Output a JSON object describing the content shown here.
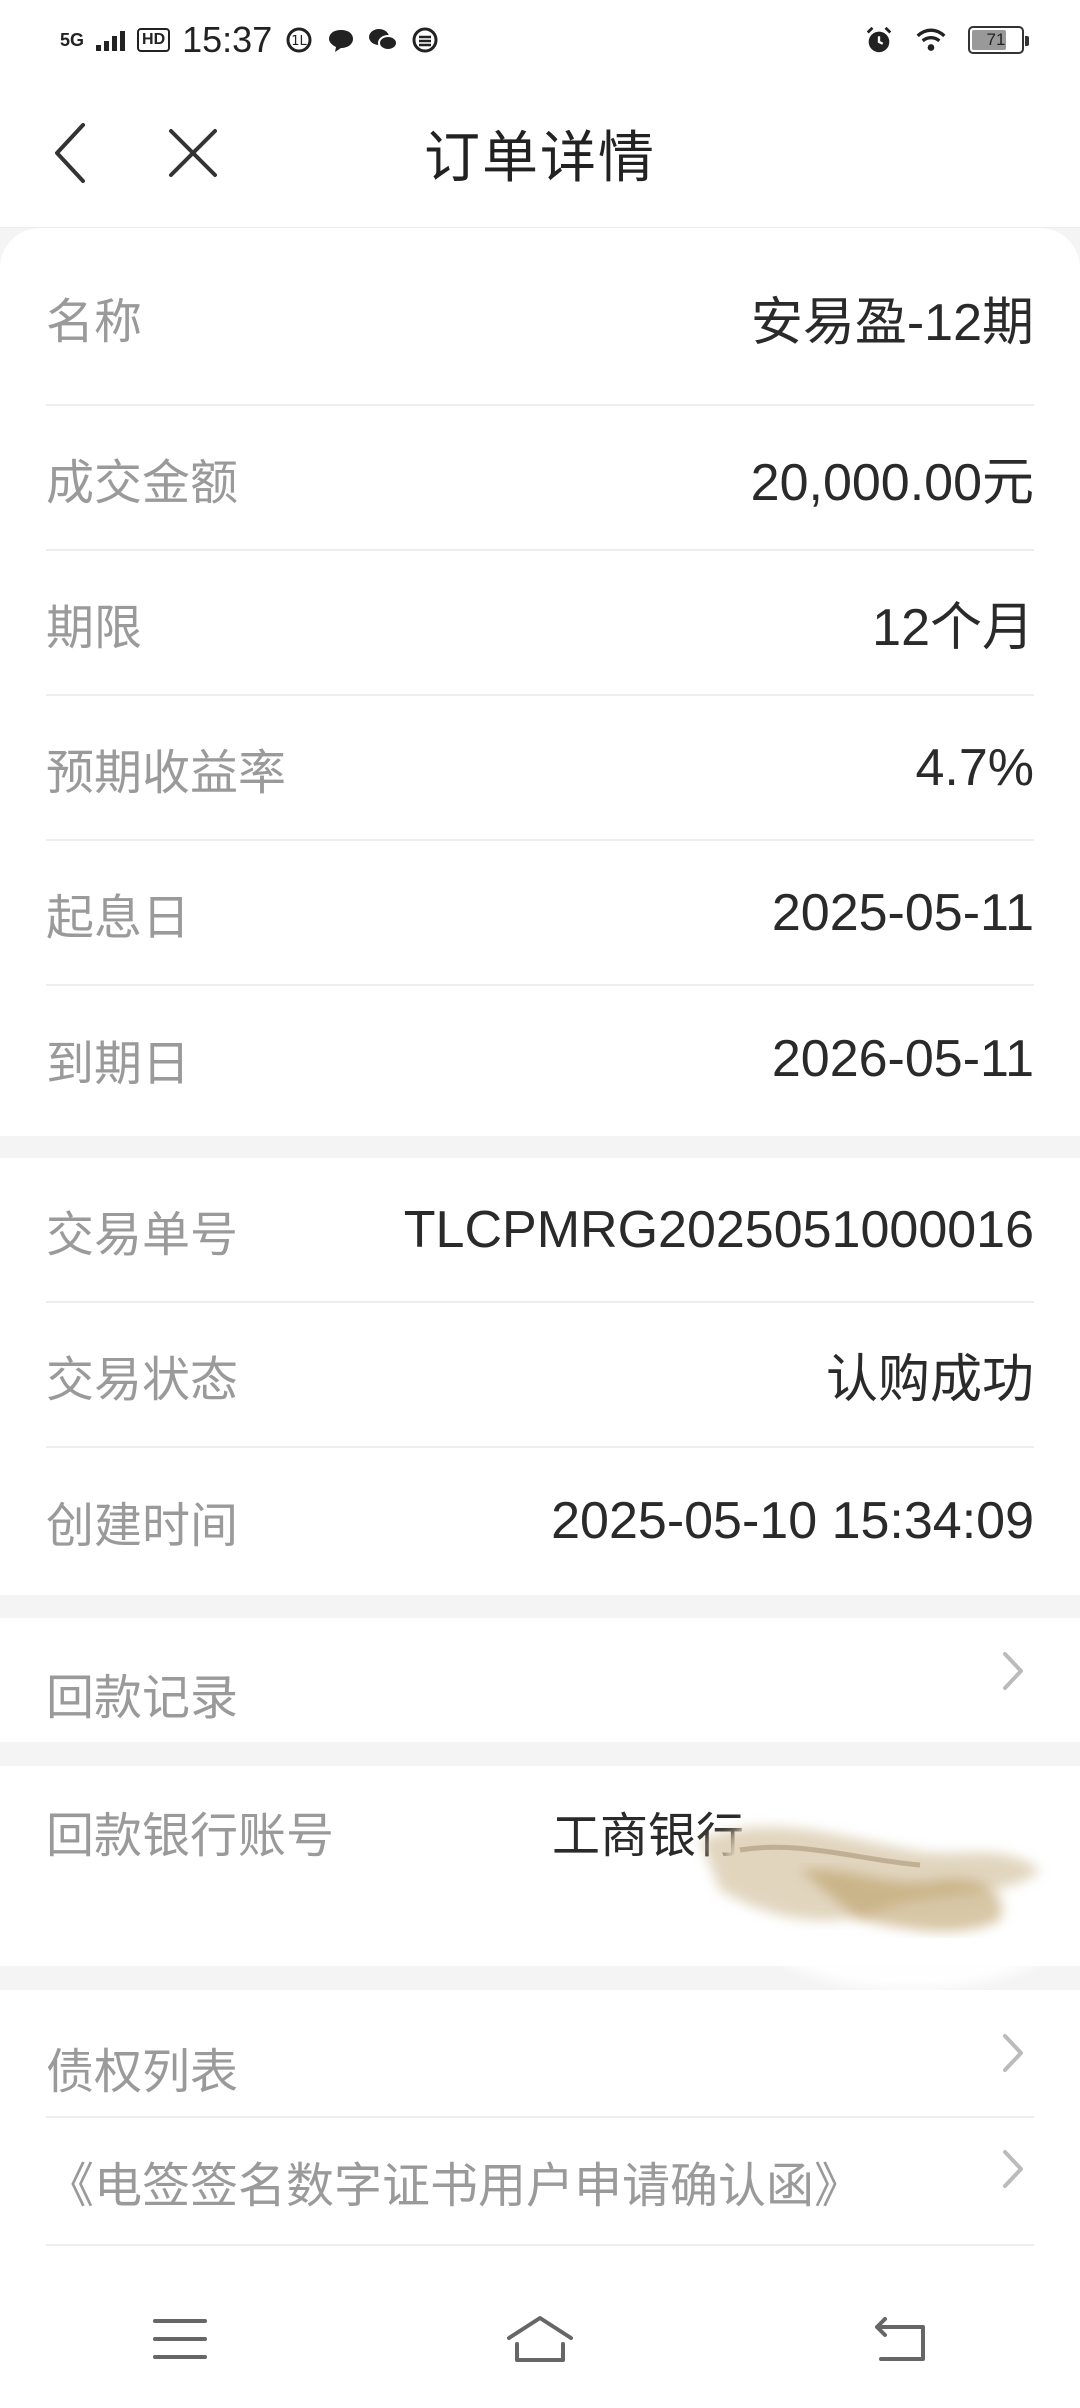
{
  "status_bar": {
    "network": "5G",
    "hd": "HD",
    "time": "15:37",
    "battery": "71",
    "battery_level": 0.71
  },
  "nav": {
    "title": "订单详情"
  },
  "order": {
    "rows": [
      {
        "label": "名称",
        "value": "安易盈-12期"
      },
      {
        "label": "成交金额",
        "value": "20,000.00元"
      },
      {
        "label": "期限",
        "value": "12个月"
      },
      {
        "label": "预期收益率",
        "value": "4.7%"
      },
      {
        "label": "起息日",
        "value": "2025-05-11"
      },
      {
        "label": "到期日",
        "value": "2026-05-11"
      }
    ]
  },
  "transaction": {
    "rows": [
      {
        "label": "交易单号",
        "value": "TLCPMRG2025051000016"
      },
      {
        "label": "交易状态",
        "value": "认购成功"
      },
      {
        "label": "创建时间",
        "value": "2025-05-10 15:34:09"
      }
    ]
  },
  "repayment": {
    "record_label": "回款记录",
    "bank_label": "回款银行账号",
    "bank_value": "工商银行"
  },
  "documents": {
    "debt_list_label": "债权列表",
    "certificate_label": "《电签签名数字证书用户申请确认函》"
  }
}
